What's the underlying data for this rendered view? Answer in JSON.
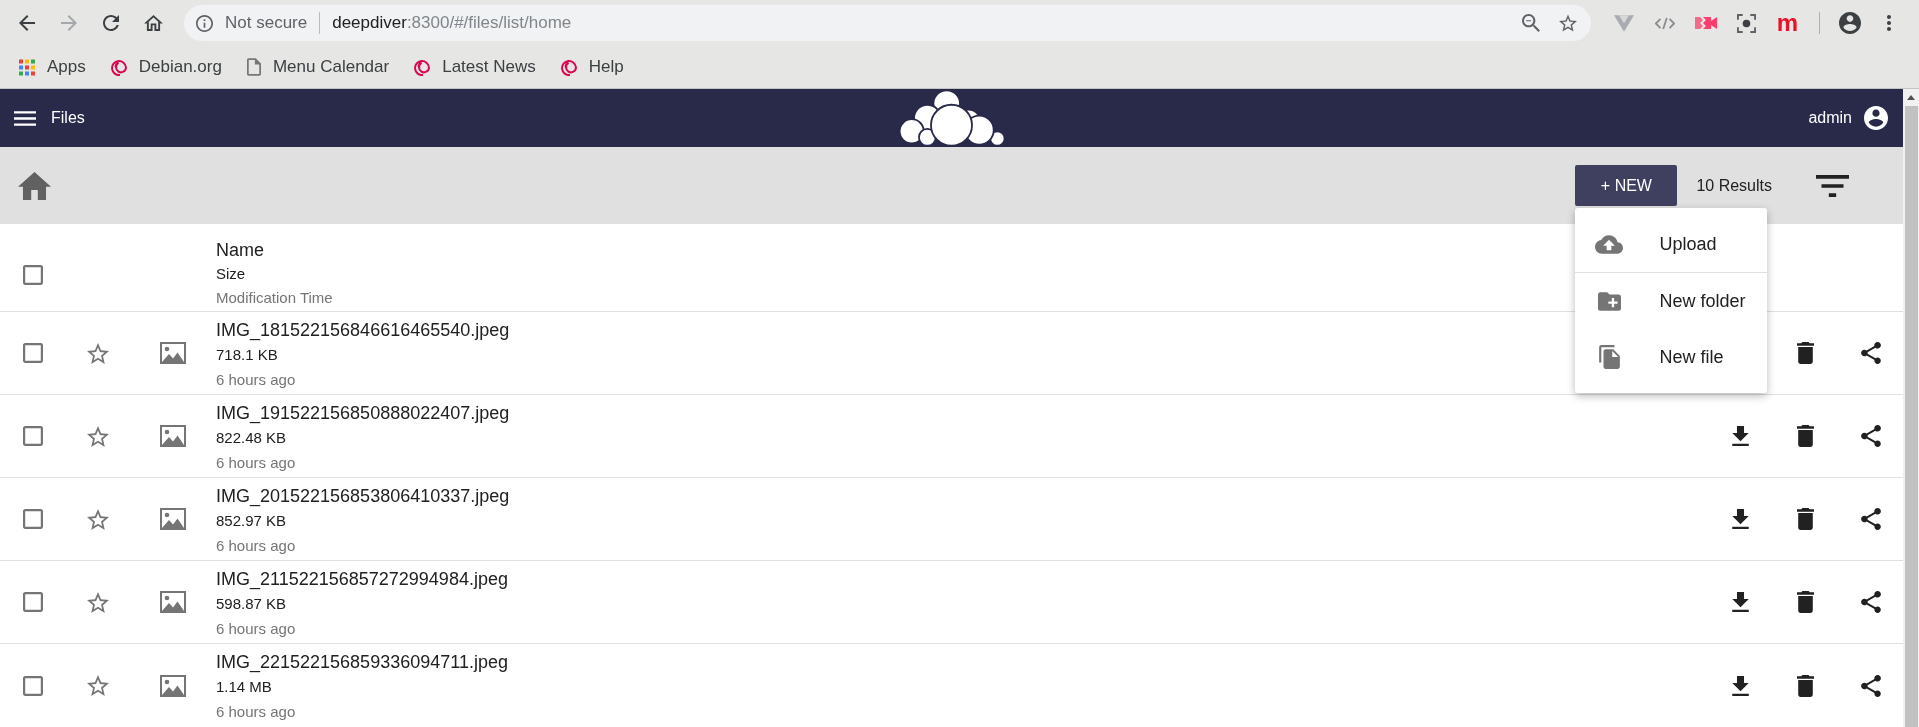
{
  "browser": {
    "nav_buttons": [
      {
        "kind": "back",
        "disabled": false
      },
      {
        "kind": "forward",
        "disabled": true
      },
      {
        "kind": "reload",
        "disabled": false
      },
      {
        "kind": "home",
        "disabled": false
      }
    ],
    "security_label": "Not secure",
    "url": {
      "host": "deepdiver",
      "path": ":8300/#/files/list/home"
    },
    "extension_label": "m",
    "bookmarks": [
      {
        "kind": "apps",
        "label": "Apps"
      },
      {
        "kind": "debian",
        "label": "Debian.org"
      },
      {
        "kind": "page",
        "label": "Menu Calendar"
      },
      {
        "kind": "debian",
        "label": "Latest News"
      },
      {
        "kind": "debian",
        "label": "Help"
      }
    ]
  },
  "app_bar": {
    "title": "Files",
    "user": "admin"
  },
  "toolbar": {
    "new_button": "+ NEW",
    "results": "10 Results"
  },
  "new_menu": {
    "open": true,
    "sections": [
      {
        "items": [
          {
            "kind": "upload",
            "label": "Upload"
          }
        ]
      },
      {
        "items": [
          {
            "kind": "folder",
            "label": "New folder"
          },
          {
            "kind": "file",
            "label": "New file"
          }
        ]
      }
    ]
  },
  "table": {
    "select_all_checked": false,
    "columns": [
      "Name",
      "Size",
      "Modification Time"
    ],
    "rows": [
      {
        "name": "IMG_181522156846616465540.jpeg",
        "size": "718.1 KB",
        "modified": "6 hours ago",
        "checked": false,
        "starred": false,
        "actions": [
          {
            "kind": "delete"
          },
          {
            "kind": "share"
          }
        ]
      },
      {
        "name": "IMG_191522156850888022407.jpeg",
        "size": "822.48 KB",
        "modified": "6 hours ago",
        "checked": false,
        "starred": false,
        "actions": [
          {
            "kind": "download"
          },
          {
            "kind": "delete"
          },
          {
            "kind": "share"
          }
        ]
      },
      {
        "name": "IMG_201522156853806410337.jpeg",
        "size": "852.97 KB",
        "modified": "6 hours ago",
        "checked": false,
        "starred": false,
        "actions": [
          {
            "kind": "download"
          },
          {
            "kind": "delete"
          },
          {
            "kind": "share"
          }
        ]
      },
      {
        "name": "IMG_211522156857272994984.jpeg",
        "size": "598.87 KB",
        "modified": "6 hours ago",
        "checked": false,
        "starred": false,
        "actions": [
          {
            "kind": "download"
          },
          {
            "kind": "delete"
          },
          {
            "kind": "share"
          }
        ]
      },
      {
        "name": "IMG_221522156859336094711.jpeg",
        "size": "1.14 MB",
        "modified": "6 hours ago",
        "checked": false,
        "starred": false,
        "actions": [
          {
            "kind": "download"
          },
          {
            "kind": "delete"
          },
          {
            "kind": "share"
          }
        ]
      }
    ]
  }
}
